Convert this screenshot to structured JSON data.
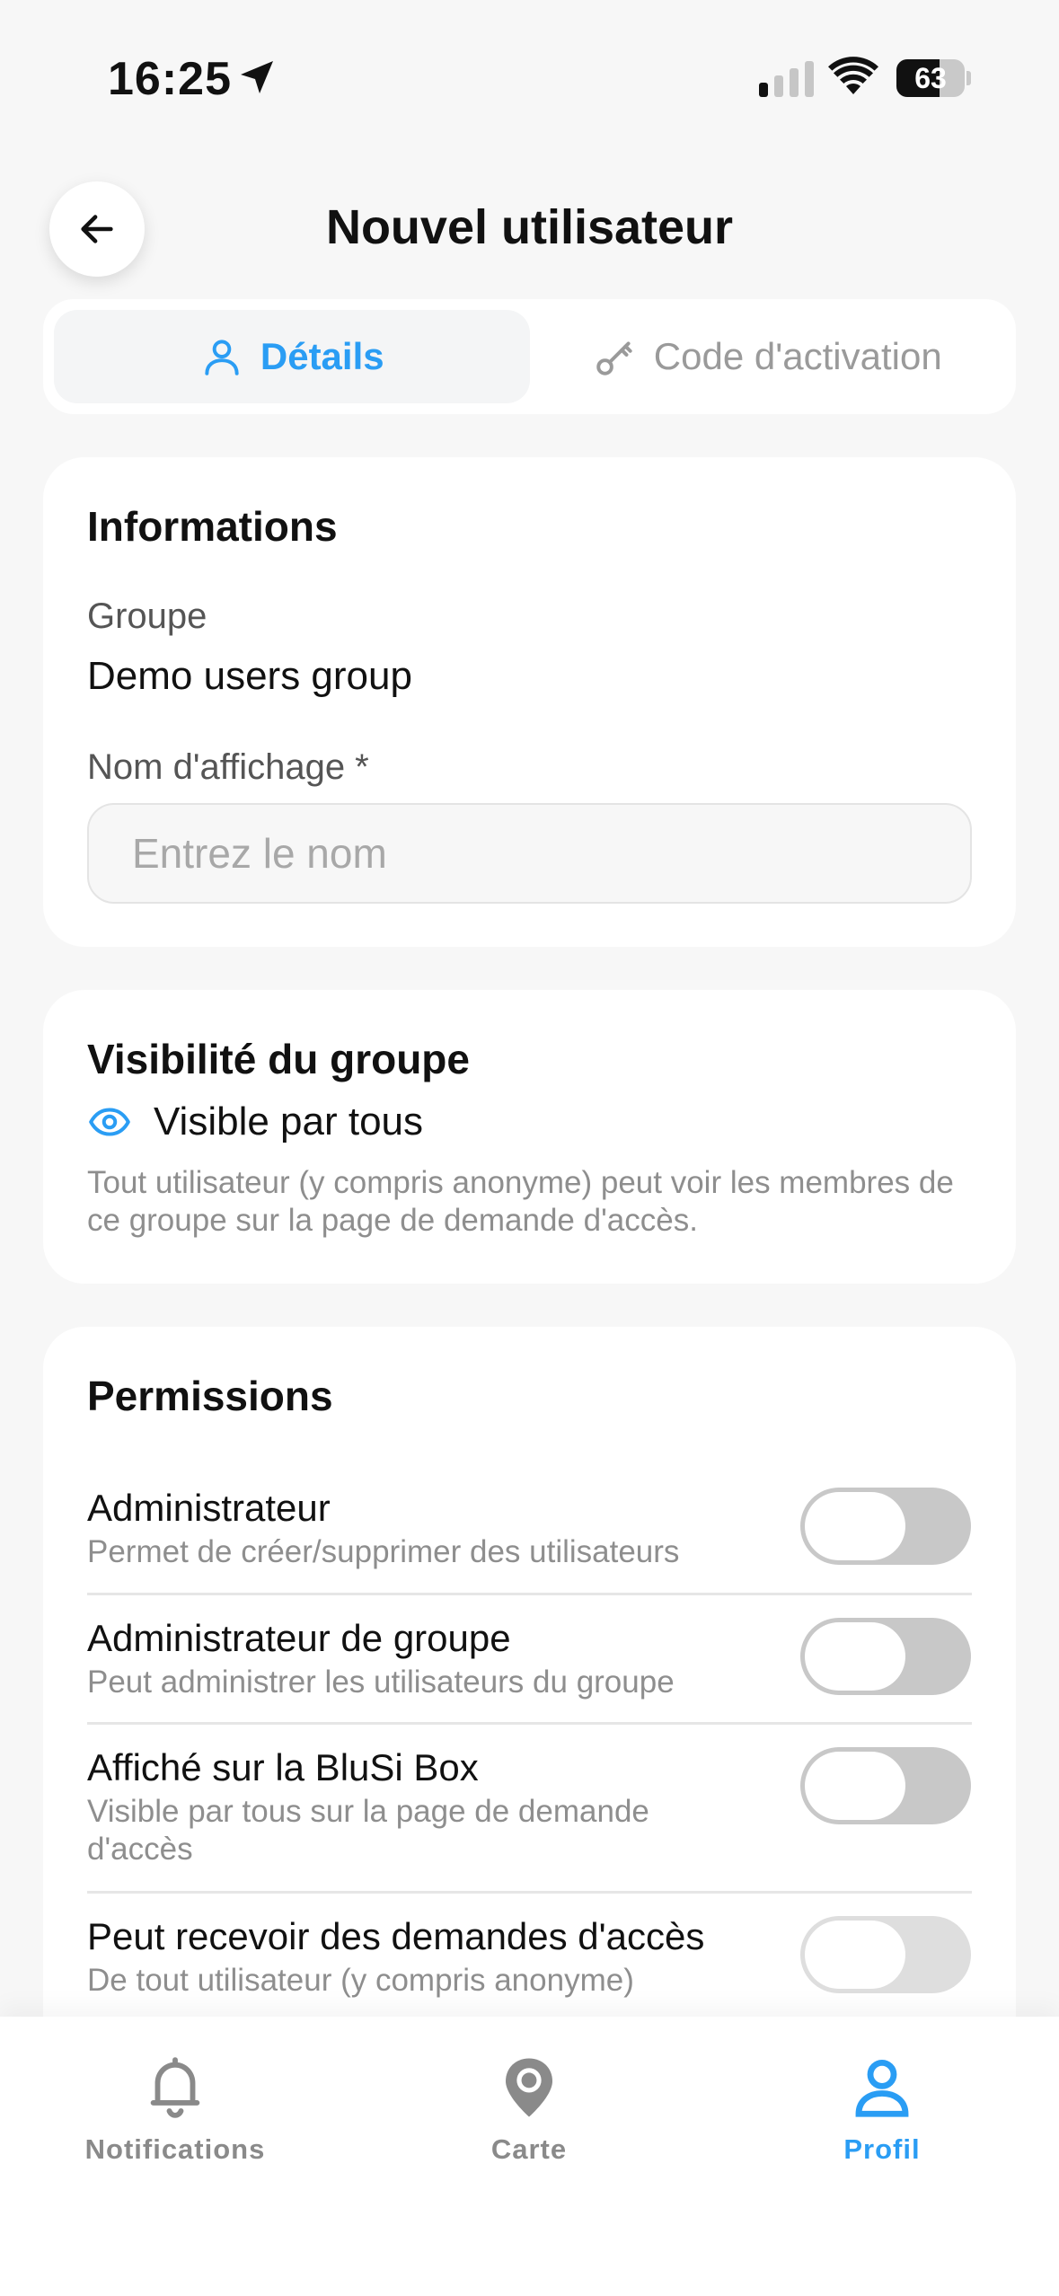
{
  "status": {
    "time": "16:25",
    "battery": "63",
    "battery_level": 0.63
  },
  "header": {
    "title": "Nouvel utilisateur",
    "back_icon": "arrow-left-icon"
  },
  "tabs": [
    {
      "label": "Détails",
      "icon": "user-icon",
      "active": true
    },
    {
      "label": "Code d'activation",
      "icon": "key-icon",
      "active": false
    }
  ],
  "informations": {
    "title": "Informations",
    "group_label": "Groupe",
    "group_value": "Demo users group",
    "name_label": "Nom d'affichage *",
    "name_placeholder": "Entrez le nom",
    "name_value": ""
  },
  "visibility": {
    "title": "Visibilité du groupe",
    "option_label": "Visible par tous",
    "description": "Tout utilisateur (y compris anonyme) peut voir les membres de ce groupe sur la page de demande d'accès."
  },
  "permissions": {
    "title": "Permissions",
    "items": [
      {
        "title": "Administrateur",
        "subtitle": "Permet de créer/supprimer des utilisateurs",
        "enabled": false
      },
      {
        "title": "Administrateur de groupe",
        "subtitle": "Peut administrer les utilisateurs du groupe",
        "enabled": false
      },
      {
        "title": "Affiché sur la BluSi Box",
        "subtitle": "Visible par tous sur la page de demande d'accès",
        "enabled": false
      },
      {
        "title": "Peut recevoir des demandes d'accès",
        "subtitle": "De tout utilisateur (y compris anonyme)",
        "enabled": false
      }
    ]
  },
  "tab_bar": [
    {
      "label": "Notifications",
      "icon": "bell-icon",
      "active": false
    },
    {
      "label": "Carte",
      "icon": "map-pin-icon",
      "active": false
    },
    {
      "label": "Profil",
      "icon": "user-icon",
      "active": true
    }
  ],
  "colors": {
    "accent": "#2a9df4",
    "toggle_off": "#c8c8c8",
    "muted_text": "#8e8e8e"
  }
}
